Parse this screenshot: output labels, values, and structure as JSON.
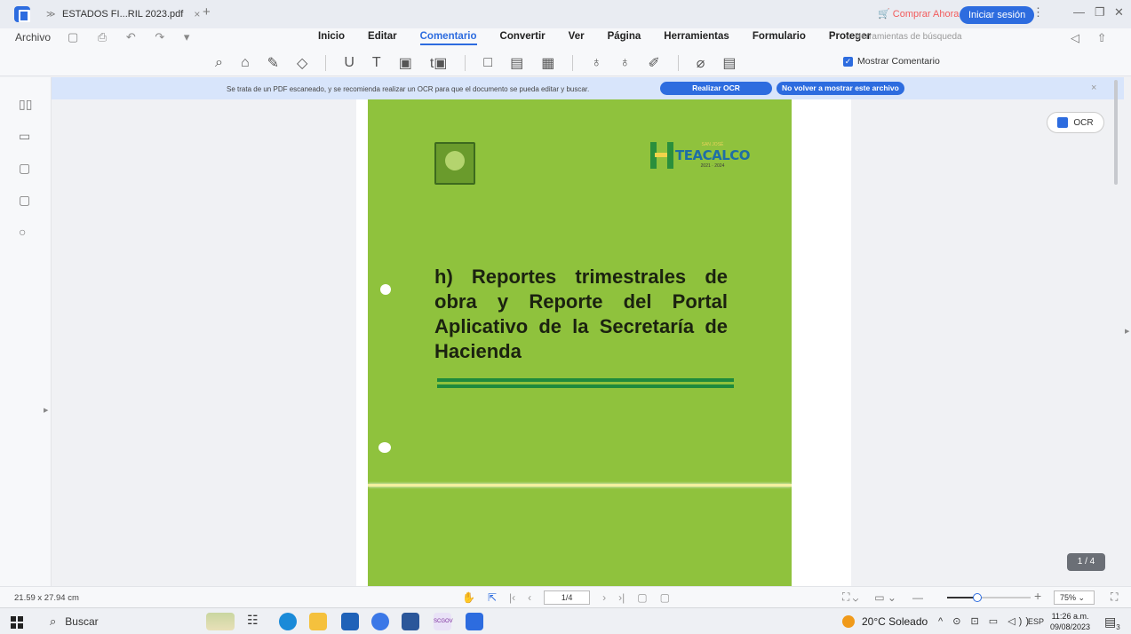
{
  "titlebar": {
    "tab_title": "ESTADOS FI...RIL 2023.pdf",
    "tab_close": "×",
    "new_tab": "+",
    "buy_label": "Comprar Ahora",
    "signin_label": "Iniciar sesión",
    "more": "⋮",
    "minimize": "—",
    "restore": "❐",
    "close": "✕"
  },
  "menubar": {
    "archivo": "Archivo",
    "quick_icons": "▢ ⎙ ↶ ↷ ▾",
    "items": [
      "Inicio",
      "Editar",
      "Comentario",
      "Convertir",
      "Ver",
      "Página",
      "Herramientas",
      "Formulario",
      "Proteger"
    ],
    "active_item": "Comentario",
    "search_tools": "Herramientas de búsqueda",
    "right_icons": "◁ ⇧ △"
  },
  "toolbar": {
    "tools": [
      "⌕",
      "⌂",
      "✎",
      "◇",
      "U",
      "T",
      "▣",
      "t▣",
      "□",
      "▤",
      "▦",
      "♁",
      "♁",
      "✐",
      "⌀",
      "▤"
    ],
    "show_comments_label": "Mostrar Comentario",
    "show_comments_checked": true
  },
  "leftrail": {
    "icons": [
      "▯▯",
      "▭",
      "▢",
      "▢",
      "○"
    ]
  },
  "banner": {
    "message": "Se trata de un PDF escaneado, y se recomienda realizar un OCR para que el documento se pueda editar y buscar.",
    "ocr_button": "Realizar OCR",
    "dismiss_button": "No volver a mostrar este archivo",
    "close": "×"
  },
  "document": {
    "logo_small": "SAN JOSÉ",
    "logo_name": "TEACALCO",
    "logo_years": "2021 · 2024",
    "heading": "h) Reportes trimestrales de obra y Reporte del Portal Aplicativo de la Secretaría de Hacienda"
  },
  "viewer": {
    "ocr_float_label": "OCR",
    "page_badge": "1 / 4"
  },
  "statusbar": {
    "dimensions": "21.59 x 27.94 cm",
    "page_input": "1/4",
    "zoom_value": "75%",
    "zoom_level": 0.36
  },
  "taskbar": {
    "search_label": "Buscar",
    "weather": "20°C  Soleado",
    "tray": "^ ⊙ ⊡ ▭ ◁))",
    "lang": "ESP",
    "time": "11:26 a.m.",
    "date": "09/08/2023",
    "notif_count": "3"
  },
  "colors": {
    "accent": "#2d6cdf",
    "page_green": "#8fc23d",
    "buy": "#f25c5c"
  }
}
